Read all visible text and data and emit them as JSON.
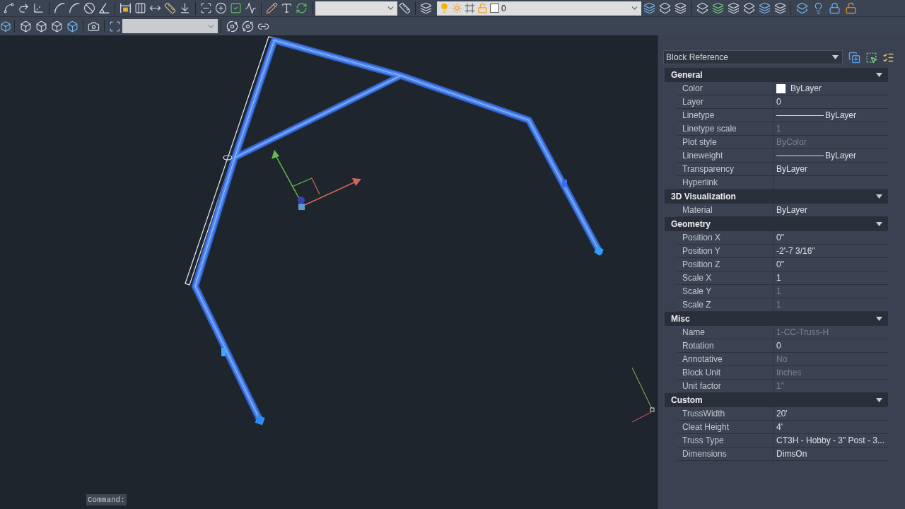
{
  "toolbar": {
    "layer_dropdown": {
      "value": "0"
    }
  },
  "canvas": {
    "command_line": {
      "prompt": "Command:"
    }
  },
  "properties": {
    "object_type": "Block Reference",
    "sections": [
      {
        "title": "General",
        "expanded": true,
        "rows": [
          {
            "label": "Color",
            "value": "ByLayer",
            "kind": "swatch",
            "color": "#ffffff",
            "disabled": false
          },
          {
            "label": "Layer",
            "value": "0",
            "kind": "text",
            "disabled": false
          },
          {
            "label": "Linetype",
            "value": "ByLayer",
            "kind": "line",
            "disabled": false
          },
          {
            "label": "Linetype scale",
            "value": "1",
            "kind": "text",
            "disabled": true
          },
          {
            "label": "Plot style",
            "value": "ByColor",
            "kind": "text",
            "disabled": true
          },
          {
            "label": "Lineweight",
            "value": "ByLayer",
            "kind": "line",
            "disabled": false
          },
          {
            "label": "Transparency",
            "value": "ByLayer",
            "kind": "text",
            "disabled": false
          },
          {
            "label": "Hyperlink",
            "kind": "text",
            "disabled": false
          }
        ]
      },
      {
        "title": "3D Visualization",
        "expanded": true,
        "rows": [
          {
            "label": "Material",
            "value": "ByLayer",
            "kind": "text",
            "disabled": false
          }
        ]
      },
      {
        "title": "Geometry",
        "expanded": true,
        "rows": [
          {
            "label": "Position X",
            "value": "0\"",
            "kind": "text",
            "disabled": false
          },
          {
            "label": "Position Y",
            "value": "-2'-7 3/16\"",
            "kind": "text",
            "disabled": false
          },
          {
            "label": "Position Z",
            "value": "0\"",
            "kind": "text",
            "disabled": false
          },
          {
            "label": "Scale X",
            "value": "1",
            "kind": "text",
            "disabled": false
          },
          {
            "label": "Scale Y",
            "value": "1",
            "kind": "text",
            "disabled": true
          },
          {
            "label": "Scale Z",
            "value": "1",
            "kind": "text",
            "disabled": true
          }
        ]
      },
      {
        "title": "Misc",
        "expanded": true,
        "rows": [
          {
            "label": "Name",
            "value": "1-CC-Truss-H",
            "kind": "text",
            "disabled": true
          },
          {
            "label": "Rotation",
            "value": "0",
            "kind": "text",
            "disabled": false
          },
          {
            "label": "Annotative",
            "value": "No",
            "kind": "text",
            "disabled": true
          },
          {
            "label": "Block Unit",
            "value": "Inches",
            "kind": "text",
            "disabled": true
          },
          {
            "label": "Unit factor",
            "value": "1\"",
            "kind": "text",
            "disabled": true
          }
        ]
      },
      {
        "title": "Custom",
        "expanded": true,
        "rows": [
          {
            "label": "TrussWidth",
            "value": "20'",
            "kind": "text",
            "disabled": false
          },
          {
            "label": "Cleat Height",
            "value": "4'",
            "kind": "text",
            "disabled": false
          },
          {
            "label": "Truss Type",
            "value": "CT3H - Hobby - 3\" Post - 3...",
            "kind": "text",
            "disabled": false
          },
          {
            "label": "Dimensions",
            "value": "DimsOn",
            "kind": "text",
            "disabled": false
          }
        ]
      }
    ]
  }
}
